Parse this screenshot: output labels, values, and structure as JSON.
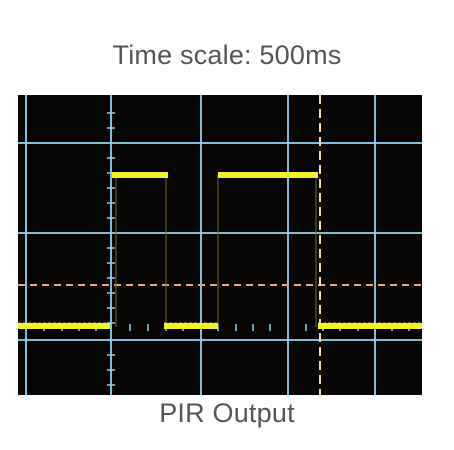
{
  "captions": {
    "top": "Time scale: 500ms",
    "bottom": "PIR Output"
  },
  "colors": {
    "background": "#ffffff",
    "caption_text": "#555555",
    "screen": "#070605",
    "grid": "#8fd3f4",
    "trace": "#f2f22a",
    "cursor_horizontal": "#f0a36c",
    "cursor_vertical": "#f6d9b0"
  },
  "scope": {
    "grid": true,
    "trace": {
      "levels": [
        "low",
        "high",
        "low",
        "high",
        "low"
      ],
      "pulse_count": 2
    }
  }
}
